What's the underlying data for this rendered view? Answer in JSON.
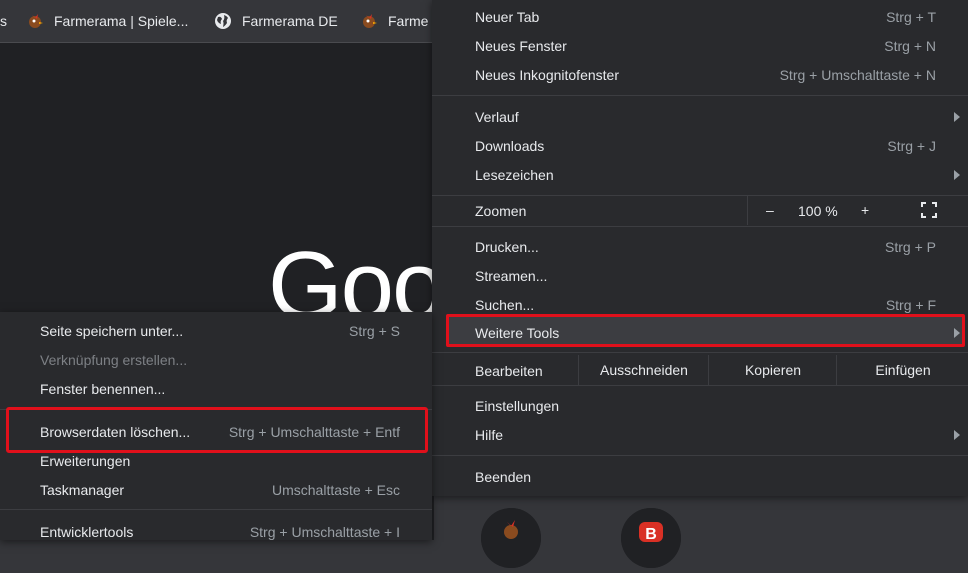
{
  "bookmarks": [
    {
      "label": "s"
    },
    {
      "label": "Farmerama | Spiele..."
    },
    {
      "label": "Farmerama DE"
    },
    {
      "label": "Farme"
    }
  ],
  "page": {
    "logo_text": "Goo"
  },
  "main_menu": {
    "items_group1": [
      {
        "label": "Neuer Tab",
        "shortcut": "Strg + T"
      },
      {
        "label": "Neues Fenster",
        "shortcut": "Strg + N"
      },
      {
        "label": "Neues Inkognitofenster",
        "shortcut": "Strg + Umschalttaste + N"
      }
    ],
    "items_group2": [
      {
        "label": "Verlauf",
        "shortcut": ""
      },
      {
        "label": "Downloads",
        "shortcut": "Strg + J"
      },
      {
        "label": "Lesezeichen",
        "shortcut": ""
      }
    ],
    "zoom": {
      "label": "Zoomen",
      "minus": "–",
      "value": "100 %",
      "plus": "+"
    },
    "items_group3": [
      {
        "label": "Drucken...",
        "shortcut": "Strg + P"
      },
      {
        "label": "Streamen...",
        "shortcut": ""
      },
      {
        "label": "Suchen...",
        "shortcut": "Strg + F"
      },
      {
        "label": "Weitere Tools",
        "shortcut": ""
      }
    ],
    "edit": {
      "label": "Bearbeiten",
      "cut": "Ausschneiden",
      "copy": "Kopieren",
      "paste": "Einfügen"
    },
    "items_group4": [
      {
        "label": "Einstellungen",
        "shortcut": ""
      },
      {
        "label": "Hilfe",
        "shortcut": ""
      }
    ],
    "exit": {
      "label": "Beenden"
    }
  },
  "sub_menu": {
    "items_group1": [
      {
        "label": "Seite speichern unter...",
        "shortcut": "Strg + S"
      },
      {
        "label": "Verknüpfung erstellen...",
        "shortcut": ""
      },
      {
        "label": "Fenster benennen...",
        "shortcut": ""
      }
    ],
    "items_group2": [
      {
        "label": "Browserdaten löschen...",
        "shortcut": "Strg + Umschalttaste + Entf"
      },
      {
        "label": "Erweiterungen",
        "shortcut": ""
      },
      {
        "label": "Taskmanager",
        "shortcut": "Umschalttaste + Esc"
      }
    ],
    "items_group3": [
      {
        "label": "Entwicklertools",
        "shortcut": "Strg + Umschalttaste + I"
      }
    ]
  },
  "colors": {
    "highlight": "#e0101b",
    "menu_bg": "#292a2d"
  }
}
